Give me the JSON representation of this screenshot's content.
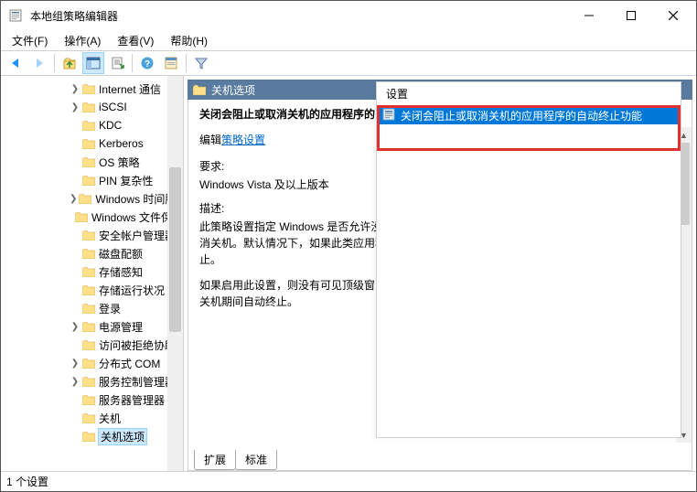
{
  "window": {
    "title": "本地组策略编辑器"
  },
  "menubar": [
    "文件(F)",
    "操作(A)",
    "查看(V)",
    "帮助(H)"
  ],
  "tree": {
    "items": [
      {
        "label": "Internet 通信",
        "expand": ">"
      },
      {
        "label": "iSCSI",
        "expand": ">"
      },
      {
        "label": "KDC",
        "expand": ""
      },
      {
        "label": "Kerberos",
        "expand": ""
      },
      {
        "label": "OS 策略",
        "expand": ""
      },
      {
        "label": "PIN 复杂性",
        "expand": ""
      },
      {
        "label": "Windows 时间服务",
        "expand": ">"
      },
      {
        "label": "Windows 文件保护",
        "expand": ""
      },
      {
        "label": "安全帐户管理器",
        "expand": ""
      },
      {
        "label": "磁盘配额",
        "expand": ""
      },
      {
        "label": "存储感知",
        "expand": ""
      },
      {
        "label": "存储运行状况",
        "expand": ""
      },
      {
        "label": "登录",
        "expand": ""
      },
      {
        "label": "电源管理",
        "expand": ">"
      },
      {
        "label": "访问被拒绝协助",
        "expand": ""
      },
      {
        "label": "分布式 COM",
        "expand": ">"
      },
      {
        "label": "服务控制管理器",
        "expand": ">"
      },
      {
        "label": "服务器管理器",
        "expand": ""
      },
      {
        "label": "关机",
        "expand": ""
      },
      {
        "label": "关机选项",
        "expand": "",
        "selected": true
      }
    ],
    "indent": 75
  },
  "rightHeader": "关机选项",
  "detail": {
    "title": "关闭会阻止或取消关机的应用程序的自动终止功能",
    "editPrefix": "编辑",
    "editLink": "策略设置",
    "reqLabel": "要求:",
    "reqText": "Windows Vista 及以上版本",
    "descLabel": "描述:",
    "desc1": "此策略设置指定 Windows 是否允许没有可见顶级窗口的控制台应用程序和 GUI 应用程序阻止或取消关机。默认情况下，如果此类应用程序无限期地试图取消或阻止关机，则这些应用程序会自动终止。",
    "desc2": "如果启用此设置，则没有可见顶级窗口且阻止或取消关机的控制台应用程序或 GUI 应用程序不会在关机期间自动终止。"
  },
  "tabs": {
    "extended": "扩展",
    "standard": "标准"
  },
  "list": {
    "colhead": "设置",
    "item": "关闭会阻止或取消关机的应用程序的自动终止功能"
  },
  "status": "1 个设置"
}
